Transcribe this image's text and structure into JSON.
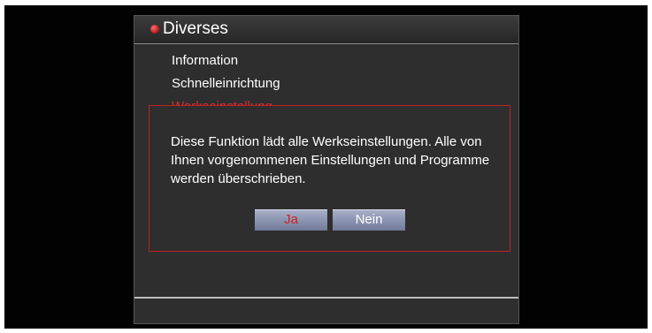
{
  "menu": {
    "title": "Diverses",
    "items": [
      {
        "label": "Information"
      },
      {
        "label": "Schnelleinrichtung"
      },
      {
        "label": "Werkseinstellung"
      }
    ]
  },
  "dialog": {
    "message": "Diese Funktion lädt alle Werkseinstellungen. Alle von Ihnen vorgenommenen Einstellungen und Programme werden überschrieben.",
    "yes_label": "Ja",
    "no_label": "Nein"
  },
  "colors": {
    "frame": "#020202",
    "panel": "#2e2e2e",
    "accent": "#c21f25",
    "button": "#8f98b3"
  }
}
